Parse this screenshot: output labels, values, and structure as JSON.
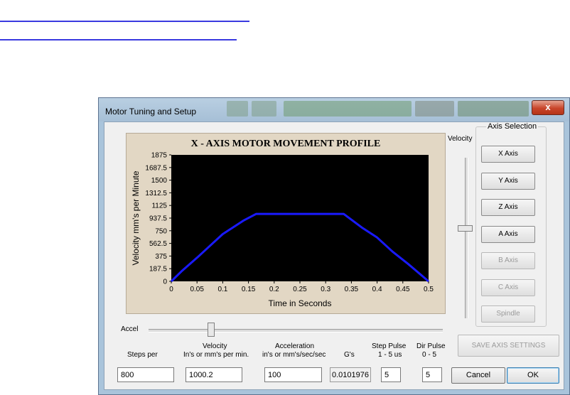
{
  "window": {
    "title": "Motor Tuning and Setup",
    "close_glyph": "x"
  },
  "chart_data": {
    "type": "line",
    "title": "X - AXIS MOTOR MOVEMENT PROFILE",
    "xlabel": "Time in Seconds",
    "ylabel": "Velocity mm's per Minute",
    "x_ticks": [
      "0",
      "0.05",
      "0.1",
      "0.15",
      "0.2",
      "0.25",
      "0.3",
      "0.35",
      "0.4",
      "0.45",
      "0.5"
    ],
    "y_ticks": [
      "1875",
      "1687.5",
      "1500",
      "1312.5",
      "1125",
      "937.5",
      "750",
      "562.5",
      "375",
      "187.5",
      "0"
    ],
    "xlim": [
      0,
      0.5
    ],
    "ylim": [
      0,
      1875
    ],
    "background": "#000000",
    "line_color": "#1a1aff",
    "series": [
      {
        "x": [
          0,
          0.02,
          0.05,
          0.08,
          0.1,
          0.14,
          0.165,
          0.335,
          0.37,
          0.4,
          0.43,
          0.46,
          0.5
        ],
        "y": [
          0,
          150,
          350,
          560,
          700,
          900,
          1000,
          1000,
          800,
          650,
          440,
          260,
          0
        ]
      }
    ]
  },
  "velocity_slider": {
    "label": "Velocity",
    "value": 0.44
  },
  "accel_slider": {
    "label": "Accel",
    "value": 0.2
  },
  "axis_selection": {
    "title": "Axis Selection",
    "buttons": [
      "X Axis",
      "Y Axis",
      "Z Axis",
      "A Axis",
      "B Axis",
      "C Axis",
      "Spindle"
    ]
  },
  "save_button": "SAVE AXIS SETTINGS",
  "fields": {
    "steps_per": {
      "label": "Steps per",
      "value": "800"
    },
    "velocity": {
      "label_line1": "Velocity",
      "label_line2": "In's or mm's per min.",
      "value": "1000.2"
    },
    "acceleration": {
      "label_line1": "Acceleration",
      "label_line2": "in's or mm's/sec/sec",
      "value": "100"
    },
    "gs": {
      "label": "G's",
      "value": "0.0101976"
    },
    "step_pulse": {
      "label_line1": "Step Pulse",
      "label_line2": "1 - 5 us",
      "value": "5"
    },
    "dir_pulse": {
      "label_line1": "Dir Pulse",
      "label_line2": "0 - 5",
      "value": "5"
    }
  },
  "buttons": {
    "cancel": "Cancel",
    "ok": "OK"
  }
}
